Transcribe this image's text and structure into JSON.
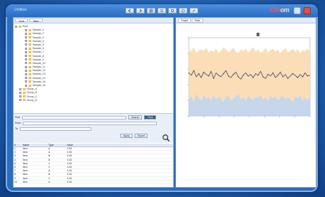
{
  "window": {
    "title": "Untitled",
    "logo_main": "Chr",
    "logo_accent": "om"
  },
  "toolbar": {
    "buttons": [
      {
        "name": "back-button",
        "icon": "arrow-left-icon"
      },
      {
        "name": "forward-button",
        "icon": "arrow-right-icon"
      },
      {
        "name": "grid-button",
        "icon": "grid-icon"
      },
      {
        "name": "list-button",
        "icon": "list-icon"
      },
      {
        "name": "settings-button",
        "icon": "gear-icon"
      },
      {
        "name": "help-button",
        "icon": "question-icon"
      },
      {
        "name": "tool-button",
        "icon": "wrench-icon"
      }
    ]
  },
  "left_panel": {
    "tabs": [
      "Tree",
      "Tabs"
    ],
    "tree_items": [
      "Root",
      "Sample_1",
      "Sample_2",
      "Sample_3",
      "Sample_4",
      "Sample_5",
      "Sample_6",
      "Sample_7",
      "Sample_8",
      "Sample_9",
      "Sample_10",
      "Sample_11",
      "Sample_12",
      "Sample_13",
      "Sample_14",
      "Sample_15",
      "Sample_16",
      "Group_A",
      "Group_B",
      "Group_C",
      "Group_D"
    ]
  },
  "search": {
    "label_1": "Find",
    "label_2": "From",
    "label_3": "To",
    "input_1": "",
    "input_2": "",
    "input_3": "",
    "search_button": "Search",
    "clear_button": "Clear",
    "apply_button": "Apply",
    "export_button": "Export"
  },
  "results": {
    "columns": [
      "#",
      "Name",
      "Type",
      "Value"
    ],
    "rows": [
      [
        "1",
        "Item",
        "A",
        "0.00"
      ],
      [
        "2",
        "Item",
        "A",
        "0.00"
      ],
      [
        "3",
        "Item",
        "B",
        "0.00"
      ],
      [
        "4",
        "Item",
        "B",
        "0.00"
      ],
      [
        "5",
        "Item",
        "C",
        "0.00"
      ],
      [
        "6",
        "Item",
        "C",
        "0.00"
      ],
      [
        "7",
        "Item",
        "A",
        "0.00"
      ],
      [
        "8",
        "Item",
        "B",
        "0.00"
      ],
      [
        "9",
        "Item",
        "C",
        "0.00"
      ],
      [
        "10",
        "Item",
        "A",
        "0.00"
      ]
    ]
  },
  "right_panel": {
    "tabs": [
      "Graph",
      "Data"
    ],
    "chart_title": ""
  },
  "colors": {
    "accent": "#2a6cc0",
    "band": "#fbd9b0",
    "band_lower": "#b9cde6",
    "line": "#3e4a5a"
  },
  "chart_data": {
    "type": "line",
    "title": "",
    "xlabel": "",
    "ylabel": "",
    "x": [
      0,
      1,
      2,
      3,
      4,
      5,
      6,
      7,
      8,
      9,
      10,
      11,
      12,
      13,
      14,
      15,
      16,
      17,
      18,
      19,
      20,
      21,
      22,
      23,
      24,
      25,
      26,
      27,
      28,
      29,
      30,
      31,
      32,
      33,
      34,
      35,
      36,
      37,
      38,
      39,
      40,
      41,
      42,
      43,
      44,
      45,
      46,
      47,
      48,
      49
    ],
    "series": [
      {
        "values": [
          55,
          52,
          58,
          50,
          54,
          49,
          56,
          53,
          51,
          57,
          48,
          55,
          52,
          50,
          54,
          58,
          51,
          49,
          53,
          56,
          50,
          47,
          52,
          55,
          51,
          53,
          49,
          54,
          52,
          57,
          50,
          48,
          53,
          51,
          55,
          49,
          52,
          56,
          50,
          53,
          48,
          51,
          54,
          52,
          49,
          53,
          50,
          55,
          51,
          52
        ]
      },
      {
        "values": [
          86,
          82,
          88,
          80,
          84,
          85,
          83,
          87,
          81,
          84,
          82,
          86,
          80,
          83,
          88,
          85,
          81,
          84,
          87,
          82,
          80,
          85,
          83,
          86,
          81,
          84,
          88,
          82,
          85,
          80,
          83,
          87,
          81,
          84,
          86,
          82,
          85,
          80,
          84,
          87,
          81,
          83,
          86,
          82,
          85,
          80,
          84,
          83,
          86,
          82
        ]
      },
      {
        "values": [
          22,
          25,
          18,
          28,
          23,
          20,
          26,
          22,
          24,
          19,
          27,
          21,
          25,
          23,
          18,
          24,
          26,
          20,
          22,
          25,
          28,
          21,
          24,
          19,
          26,
          22,
          20,
          25,
          23,
          27,
          21,
          24,
          19,
          26,
          22,
          25,
          20,
          23,
          27,
          21,
          24,
          22,
          18,
          25,
          23,
          26,
          20,
          24,
          21,
          23
        ]
      }
    ],
    "ylim": [
      0,
      100
    ],
    "grid": false
  }
}
